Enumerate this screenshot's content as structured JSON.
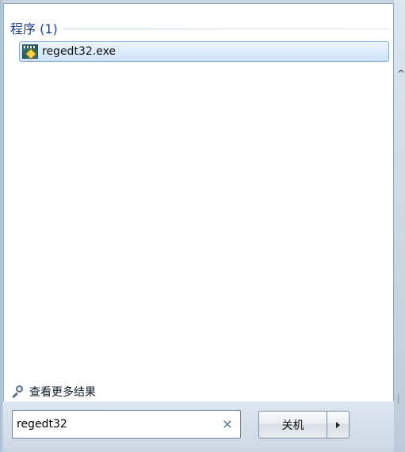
{
  "results": {
    "group_title": "程序 (1)",
    "items": [
      {
        "label": "regedt32.exe",
        "icon": "registry-editor-icon"
      }
    ],
    "more_results_label": "查看更多结果",
    "more_results_icon": "search-icon"
  },
  "search": {
    "value": "regedt32",
    "clear_symbol": "×"
  },
  "power": {
    "shutdown_label": "关机",
    "menu_icon": "chevron-right-icon"
  },
  "colors": {
    "group_title": "#1e3f8b",
    "selection_border": "#84acdd",
    "selection_fill": "#dcebfc",
    "bottom_bar": "#d6e0ea"
  }
}
